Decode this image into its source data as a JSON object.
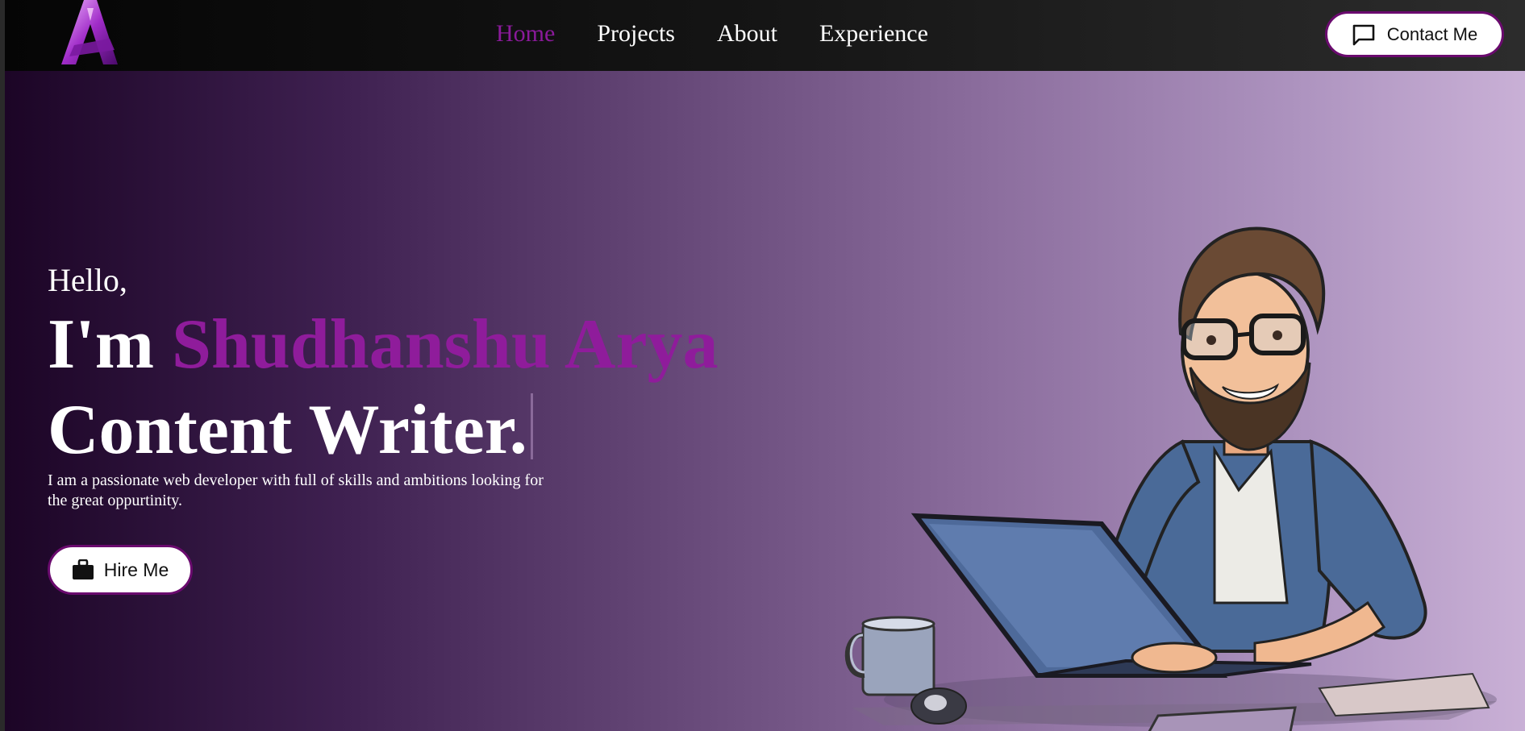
{
  "nav": {
    "items": [
      {
        "label": "Home",
        "active": true
      },
      {
        "label": "Projects",
        "active": false
      },
      {
        "label": "About",
        "active": false
      },
      {
        "label": "Experience",
        "active": false
      }
    ],
    "contact_label": "Contact Me"
  },
  "hero": {
    "greeting": "Hello,",
    "intro": "I'm",
    "name": "Shudhanshu Arya",
    "role": "Content Writer.",
    "description": "I am a passionate web developer with full of skills and ambitions looking for the great oppurtinity.",
    "hire_label": "Hire Me"
  },
  "icons": {
    "logo": "letter-a-logo",
    "contact": "chat-bubble-icon",
    "hire": "briefcase-icon"
  },
  "colors": {
    "accent": "#8f1c9b",
    "button_border": "#6a0a6e",
    "nav_bg": "#0d0d0d"
  }
}
